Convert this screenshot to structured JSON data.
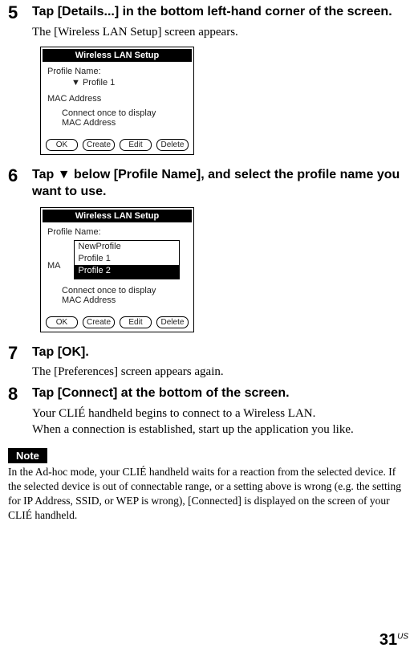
{
  "step5": {
    "num": "5",
    "title": "Tap [Details...] in the bottom left-hand corner of the screen.",
    "desc": "The [Wireless LAN Setup] screen appears."
  },
  "step6": {
    "num": "6",
    "title": "Tap ▼ below [Profile Name], and select the profile name you want to use."
  },
  "step7": {
    "num": "7",
    "title": "Tap [OK].",
    "desc": "The [Preferences] screen appears again."
  },
  "step8": {
    "num": "8",
    "title": "Tap [Connect] at the bottom of the screen.",
    "desc1": "Your CLIÉ handheld begins to connect to a Wireless LAN.",
    "desc2": "When a connection is established, start up the application you like."
  },
  "shot1": {
    "titlebar": "Wireless LAN Setup",
    "profileLabel": "Profile Name:",
    "profileValue": "▼ Profile 1",
    "macLabel": "MAC Address",
    "connectMsg1": "Connect once to display",
    "connectMsg2": "MAC Address",
    "btnOK": "OK",
    "btnCreate": "Create",
    "btnEdit": "Edit",
    "btnDelete": "Delete"
  },
  "shot2": {
    "titlebar": "Wireless LAN Setup",
    "profileLabel": "Profile Name:",
    "maPrefix": "MA",
    "opt1": "NewProfile",
    "opt2": "Profile 1",
    "opt3": "Profile 2",
    "connectMsg1": "Connect once to display",
    "connectMsg2": "MAC Address",
    "btnOK": "OK",
    "btnCreate": "Create",
    "btnEdit": "Edit",
    "btnDelete": "Delete"
  },
  "note": {
    "label": "Note",
    "text": "In the Ad-hoc mode, your CLIÉ handheld waits for a reaction from the selected device. If the selected device is out of connectable range, or a setting above is wrong (e.g. the setting for IP Address, SSID, or WEP is wrong), [Connected] is displayed on the screen of your CLIÉ handheld."
  },
  "pagenum": "31",
  "pageregion": "US"
}
